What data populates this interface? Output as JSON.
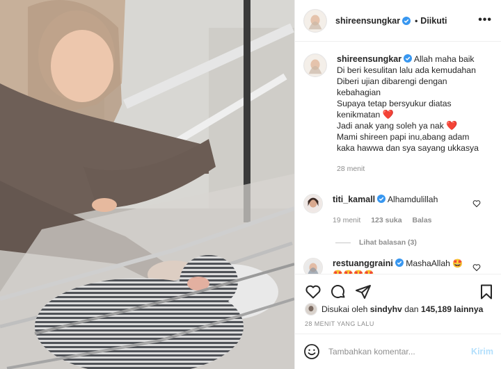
{
  "post": {
    "image_alt": "",
    "colors": {
      "accent_blue": "#0095f6",
      "verified_blue": "#3897f0",
      "heart_red": "#e2262f",
      "text": "#262626",
      "muted": "#8e8e8e"
    }
  },
  "header": {
    "username": "shireensungkar",
    "dot": "•",
    "follow_state": "Diikuti",
    "more_icon": "•••"
  },
  "caption": {
    "username": "shireensungkar",
    "lines": [
      "Allah maha baik",
      "Di beri kesulitan lalu ada kemudahan",
      "Diberi ujian dibarengi dengan",
      "kebahagian",
      "Supaya tetap bersyukur diatas",
      "kenikmatan",
      "Jadi anak yang soleh ya nak",
      "Mami shireen papi inu,abang adam",
      "kaka hawwa dan sya sayang ukkasya"
    ],
    "heart_emoji": "❤️",
    "time": "28 menit"
  },
  "comments": [
    {
      "username": "titi_kamall",
      "text": "Alhamdulillah",
      "time": "19 menit",
      "likes": "123 suka",
      "reply": "Balas",
      "view_replies": "Lihat balasan (3)"
    },
    {
      "username": "restuanggraini",
      "text": "MashaAllah",
      "emoji_inline": "🤩",
      "emoji_line": "🤩🤩🤩🤩"
    }
  ],
  "actions": {
    "like_icon": "heart-outline",
    "comment_icon": "comment-bubble",
    "share_icon": "paper-plane",
    "save_icon": "bookmark"
  },
  "likes": {
    "prefix": "Disukai oleh",
    "user": "sindyhv",
    "middle": "dan",
    "count": "145,189 lainnya"
  },
  "timestamp": "28 MENIT YANG LALU",
  "add_comment": {
    "placeholder": "Tambahkan komentar...",
    "post_label": "Kirim"
  }
}
